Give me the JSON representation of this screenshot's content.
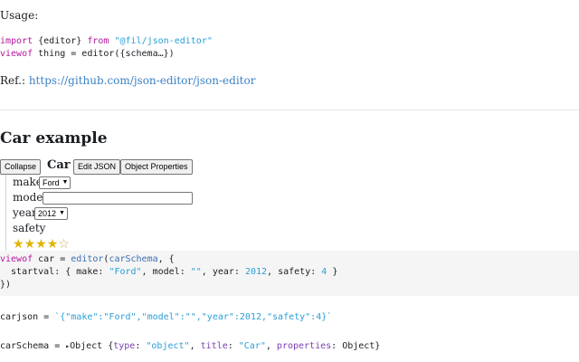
{
  "usage": {
    "heading": "Usage:",
    "line1": {
      "kw1": "import",
      "mid": " {editor} ",
      "kw2": "from",
      "space": " ",
      "str": "\"@fil/json-editor\""
    },
    "line2": {
      "kw": "viewof",
      "rest": " thing = editor({schema…})"
    },
    "ref_label": "Ref.: ",
    "ref_link": "https://github.com/json-editor/json-editor"
  },
  "car_example": {
    "title": "Car example",
    "collapse_label": "Collapse",
    "form_title": "Car",
    "edit_json_label": "Edit JSON",
    "object_properties_label": "Object Properties",
    "fields": {
      "make_label": "make",
      "make_value": "Ford",
      "model_label": "model",
      "model_value": "",
      "year_label": "year",
      "year_value": "2012",
      "safety_label": "safety",
      "safety_rating": 4,
      "safety_max": 5
    }
  },
  "code": {
    "l1": {
      "kw": "viewof",
      "a": " car = ",
      "fn": "editor",
      "b": "(",
      "arg": "carSchema",
      "c": ", {"
    },
    "l2": {
      "a": "  startval: { make: ",
      "s1": "\"Ford\"",
      "b": ", model: ",
      "s2": "\"\"",
      "c": ", year: ",
      "n1": "2012",
      "d": ", safety: ",
      "n2": "4",
      "e": " }"
    },
    "l3": "})"
  },
  "carjson": {
    "name": "carjson",
    "eq": " = ",
    "value": "`{\"make\":\"Ford\",\"model\":\"\",\"year\":2012,\"safety\":4}`"
  },
  "carschema": {
    "name": "carSchema",
    "eq": " = ",
    "arrow": "▸",
    "obj": "Object {",
    "k1": "type",
    "colon1": ": ",
    "v1": "\"object\"",
    "sep1": ", ",
    "k2": "title",
    "colon2": ": ",
    "v2": "\"Car\"",
    "sep2": ", ",
    "k3": "properties",
    "colon3": ": ",
    "v3": "Object}"
  },
  "colors": {
    "keyword": "#b5179e",
    "string": "#2a9fd6",
    "property": "#7b3fb5",
    "link": "#3b82c4",
    "star": "#e0b400"
  },
  "icons": {
    "dropdown": "chevron-down-icon",
    "star": "star-icon",
    "expand": "triangle-right-icon"
  }
}
